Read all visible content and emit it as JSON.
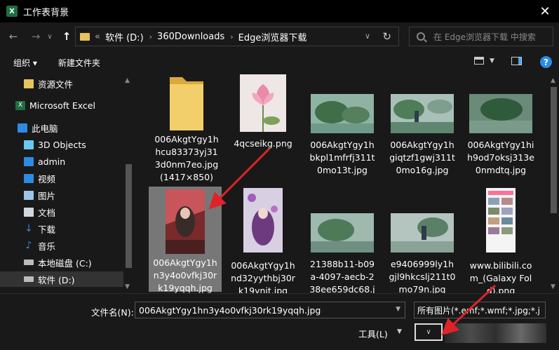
{
  "window": {
    "title": "工作表背景",
    "app_icon": "X"
  },
  "nav": {
    "back": "←",
    "forward": "→",
    "dropdown": "∨",
    "up": "↑",
    "breadcrumb": [
      "«",
      "软件 (D:)",
      "360Downloads",
      "Edge浏览器下载"
    ],
    "search_placeholder": "在 Edge浏览器下载 中搜索"
  },
  "toolbar": {
    "organize": "组织 ▾",
    "new_folder": "新建文件夹"
  },
  "sidebar": {
    "items": [
      {
        "label": "资源文件",
        "icon": "folder-icon"
      },
      {
        "label": "Microsoft Excel",
        "icon": "excel-icon"
      },
      {
        "label": "此电脑",
        "icon": "computer-icon"
      },
      {
        "label": "3D Objects",
        "icon": "3d-objects-icon"
      },
      {
        "label": "admin",
        "icon": "folder-icon"
      },
      {
        "label": "视频",
        "icon": "video-icon"
      },
      {
        "label": "图片",
        "icon": "pictures-icon"
      },
      {
        "label": "文档",
        "icon": "documents-icon"
      },
      {
        "label": "下载",
        "icon": "download-icon"
      },
      {
        "label": "音乐",
        "icon": "music-icon"
      },
      {
        "label": "本地磁盘 (C:)",
        "icon": "drive-icon"
      },
      {
        "label": "软件 (D:)",
        "icon": "drive-icon"
      }
    ]
  },
  "files": [
    {
      "name": "006AkgtYgy1hhcu83373yj313d0nm7eo.jpg (1417×850)",
      "type": "folder"
    },
    {
      "name": "4qcseikg.png",
      "type": "image"
    },
    {
      "name": "006AkgtYgy1hbkpl1mfrfj311t0mo13t.jpg",
      "type": "image"
    },
    {
      "name": "006AkgtYgy1hgiqtzf1gwj311t0mo16g.jpg",
      "type": "image"
    },
    {
      "name": "006AkgtYgy1hih9od7oksj313e0nmdtq.jpg",
      "type": "image"
    },
    {
      "name": "006AkgtYgy1hn3y4o0vfkj30rk19yqqh.jpg",
      "type": "image",
      "selected": true
    },
    {
      "name": "006AkgtYgy1hnd32yythbj30rk19ynit.jpg",
      "type": "image"
    },
    {
      "name": "21388b11-b09a-4097-aecb-238ee659dc68.jfif",
      "type": "image"
    },
    {
      "name": "e9406999ly1hgjl9hkcslj211t0mo79n.jpg",
      "type": "image"
    },
    {
      "name": "www.bilibili.com_(Galaxy Fold).png",
      "type": "image"
    }
  ],
  "footer": {
    "filename_label": "文件名(N):",
    "filename_value": "006AkgtYgy1hn3y4o0vfkj30rk19yqqh.jpg",
    "filetype_value": "所有图片(*.emf;*.wmf;*.jpg;*.j",
    "tools_label": "工具(L)"
  },
  "colors": {
    "accent": "#2b8ce2",
    "annotation": "#e0222a",
    "folder": "#e8c25b"
  }
}
